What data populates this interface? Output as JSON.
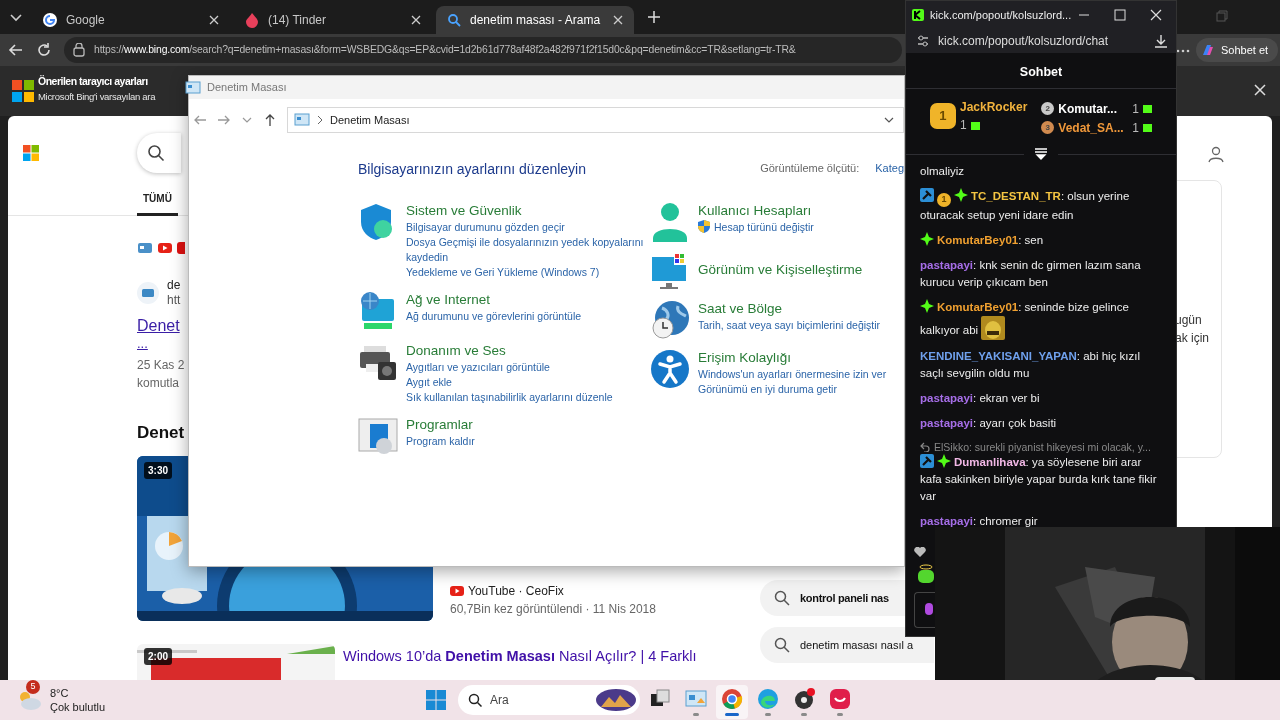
{
  "browser": {
    "tabs": [
      {
        "title": "Google",
        "selected": false
      },
      {
        "title": "(14) Tinder",
        "selected": false
      },
      {
        "title": "denetim masası - Arama",
        "selected": true
      }
    ],
    "address": "https://**www.bing.com**/search?q=denetim+masası&form=WSBEDG&qs=EP&cvid=1d2b61d778af48f2a482f971f2f15d0c&pq=denetim&cc=TR&setlang=tr-TR&",
    "side_button": "Sohbet et",
    "banner": {
      "title": "Önerilen tarayıcı ayarları",
      "text": "Microsoft Bing'i varsayılan ara"
    }
  },
  "search_page": {
    "tab": "TÜMÜ",
    "result": {
      "site": "de",
      "url": "htt",
      "title": "Denet",
      "more": "...",
      "date": "25 Kas 2",
      "snippet": "komutla"
    },
    "videos_heading": "Denet",
    "video": {
      "duration": "3:30",
      "source": "YouTube · CeoFix",
      "meta": "60,7Bin kez görüntülendi · 11 Nis 2018"
    },
    "video2": {
      "duration": "2:00",
      "title": "Windows 10’da **Denetim Masası** Nasıl Açılır? | 4 Farklı"
    },
    "related": [
      {
        "text": "kontrol paneli nas",
        "bold": true
      },
      {
        "text": "denetim masası nasıl a",
        "bold": false
      }
    ],
    "side_card": [
      "ugün",
      "ak için"
    ]
  },
  "control_panel": {
    "title": "Denetim Masası",
    "path": "Denetim Masası",
    "heading": "Bilgisayarınızın ayarlarını düzenleyin",
    "view_label": "Görüntüleme ölçütü:",
    "view_value": "Kateg",
    "columns": [
      [
        {
          "title": "Sistem ve Güvenlik",
          "links": [
            {
              "text": "Bilgisayar durumunu gözden geçir"
            },
            {
              "text": "Dosya Geçmişi ile dosyalarınızın yedek kopyalarını kaydedin"
            },
            {
              "text": "Yedekleme ve Geri Yükleme (Windows 7)"
            }
          ]
        },
        {
          "title": "Ağ ve Internet",
          "links": [
            {
              "text": "Ağ durumunu ve görevlerini görüntüle"
            }
          ]
        },
        {
          "title": "Donanım ve Ses",
          "links": [
            {
              "text": "Aygıtları ve yazıcıları görüntüle"
            },
            {
              "text": "Aygıt ekle"
            },
            {
              "text": "Sık kullanılan taşınabilirlik ayarlarını düzenle"
            }
          ]
        },
        {
          "title": "Programlar",
          "links": [
            {
              "text": "Program kaldır"
            }
          ]
        }
      ],
      [
        {
          "title": "Kullanıcı Hesapları",
          "links": [
            {
              "text": "Hesap türünü değiştir",
              "shield": true
            }
          ]
        },
        {
          "title": "Görünüm ve Kişiselleştirme"
        },
        {
          "title": "Saat ve Bölge",
          "links": [
            {
              "text": "Tarih, saat veya sayı biçimlerini değiştir"
            }
          ]
        },
        {
          "title": "Erişim Kolaylığı",
          "links": [
            {
              "text": "Windows'un ayarları önermesine izin ver"
            },
            {
              "text": "Görünümü en iyi duruma getir"
            }
          ]
        }
      ]
    ]
  },
  "chat": {
    "window_title": "kick.com/popout/kolsuzlord...",
    "url": "kick.com/popout/kolsuzlord/chat",
    "header": "Sohbet",
    "leaders": [
      {
        "rank": "1",
        "name": "JackRocker",
        "count": "1",
        "color": "#f2b33d"
      },
      {
        "rank": "2",
        "name": "Komutar...",
        "count": "1",
        "color": "#ffffff"
      },
      {
        "rank": "3",
        "name": "Vedat_SA...",
        "count": "1",
        "color": "#f0983a"
      }
    ],
    "messages": [
      {
        "kind": "text",
        "text": "olmaliyiz"
      },
      {
        "kind": "message",
        "badges": [
          {
            "kind": "mod"
          },
          {
            "kind": "sub",
            "label": "1"
          },
          {
            "kind": "verified"
          }
        ],
        "user": "TC_DESTAN_TR",
        "color": "#f5c542",
        "text": ": olsun yerine oturacak setup yeni idare edin"
      },
      {
        "kind": "message",
        "badges": [
          {
            "kind": "verified"
          }
        ],
        "user": "KomutarBey01",
        "color": "#f0a030",
        "text": ": sen"
      },
      {
        "kind": "message",
        "user": "pastapayi",
        "color": "#a66ee8",
        "text": ": knk senin dc girmen lazım sana kurucu verip çıkıcam ben"
      },
      {
        "kind": "message",
        "badges": [
          {
            "kind": "verified"
          }
        ],
        "user": "KomutarBey01",
        "color": "#f0a030",
        "text": ": seninde bize gelince kalkıyor abi",
        "emote": true
      },
      {
        "kind": "message",
        "user": "KENDINE_YAKISANI_YAPAN",
        "color": "#6fa0ec",
        "text": ": abi hiç kızıl saçlı sevgilin oldu mu"
      },
      {
        "kind": "message",
        "user": "pastapayi",
        "color": "#a66ee8",
        "text": ": ekran ver bi"
      },
      {
        "kind": "message",
        "user": "pastapayi",
        "color": "#a66ee8",
        "text": ": ayarı çok basiti"
      },
      {
        "kind": "reply",
        "text": "ElSikko: surekli piyanist hikeyesi mi olacak, y..."
      },
      {
        "kind": "message",
        "badges": [
          {
            "kind": "mod"
          },
          {
            "kind": "verified"
          }
        ],
        "user": "Dumanlihava",
        "color": "#f2b8e6",
        "text": ": ya söylesene biri arar kafa sakinken biriyle yapar burda kırk tane fikir var"
      },
      {
        "kind": "message",
        "user": "pastapayi",
        "color": "#a66ee8",
        "text": ": chromer gir"
      }
    ]
  },
  "taskbar": {
    "weather": {
      "badge": "5",
      "temp": "8°C",
      "desc": "Çok bulutlu"
    },
    "search": "Ara",
    "apps": [
      {
        "open": false,
        "selected": false
      },
      {
        "open": true,
        "selected": false
      },
      {
        "open": true,
        "selected": true
      },
      {
        "open": true,
        "selected": false
      },
      {
        "open": true,
        "selected": false
      },
      {
        "open": true,
        "selected": false
      }
    ]
  }
}
